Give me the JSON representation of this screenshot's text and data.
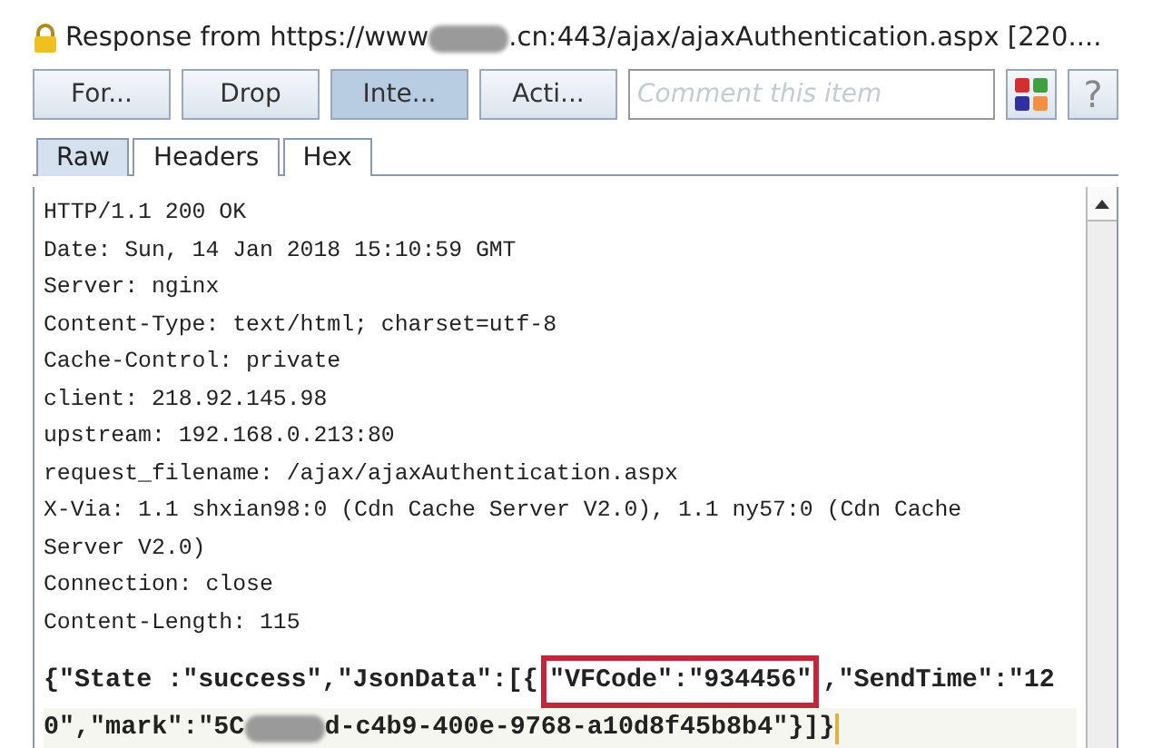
{
  "title": {
    "segments": [
      {
        "kind": "text",
        "text": "Response from https://www"
      },
      {
        "kind": "redacted"
      },
      {
        "kind": "text",
        "text": ".cn:443/ajax/ajaxAuthentication.aspx  [220...."
      }
    ]
  },
  "toolbar": {
    "buttons": [
      {
        "label": "For...",
        "selected": false
      },
      {
        "label": "Drop",
        "selected": false
      },
      {
        "label": "Inte...",
        "selected": true
      },
      {
        "label": "Acti...",
        "selected": false
      }
    ],
    "comment": {
      "placeholder": "Comment this item"
    },
    "help": "?"
  },
  "tabs": [
    {
      "label": "Raw",
      "selected": true
    },
    {
      "label": "Headers",
      "selected": false
    },
    {
      "label": "Hex",
      "selected": false
    }
  ],
  "headers": [
    "HTTP/1.1 200 OK",
    "Date: Sun, 14 Jan 2018 15:10:59 GMT",
    "Server: nginx",
    "Content-Type: text/html; charset=utf-8",
    "Cache-Control: private",
    "client: 218.92.145.98",
    "upstream: 192.168.0.213:80",
    "request_filename: /ajax/ajaxAuthentication.aspx",
    "X-Via: 1.1 shxian98:0 (Cdn Cache Server V2.0), 1.1 ny57:0 (Cdn Cache",
    "Server V2.0)",
    "Connection: close",
    "Content-Length: 115"
  ],
  "body": [
    {
      "segments": [
        {
          "kind": "text",
          "text": "{\"State :\"success\",\"JsonData\":[{"
        },
        {
          "kind": "highlight",
          "text": "\"VFCode\":\"934456\""
        },
        {
          "kind": "text",
          "text": ",\"SendTime\":\"12"
        }
      ]
    },
    {
      "segments": [
        {
          "kind": "text",
          "text": "0\",\"mark\":\"5C"
        },
        {
          "kind": "redacted"
        },
        {
          "kind": "text",
          "text": "d-c4b9-400e-9768-a10d8f45b8b4\"}]}"
        }
      ]
    }
  ]
}
